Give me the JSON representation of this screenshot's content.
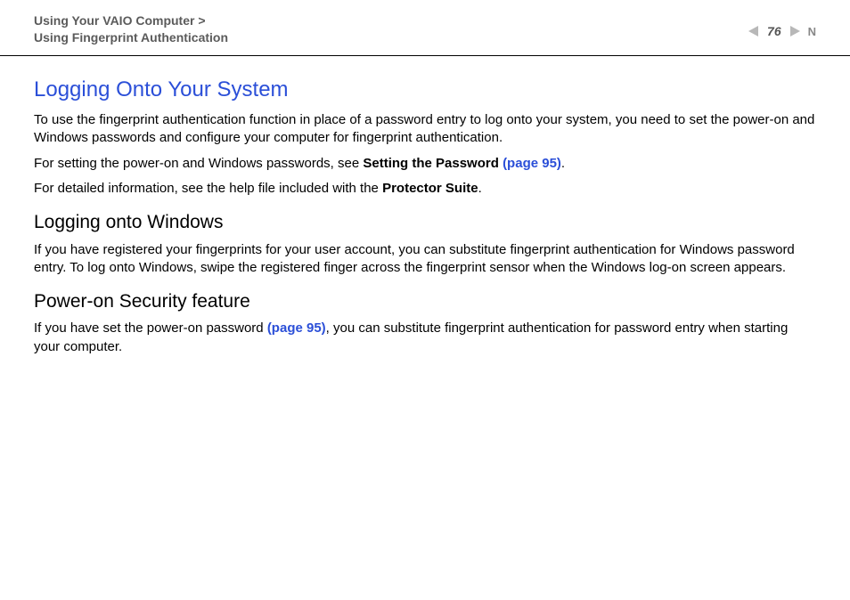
{
  "header": {
    "breadcrumb_line1": "Using Your VAIO Computer >",
    "breadcrumb_line2": "Using Fingerprint Authentication",
    "page_number": "76",
    "n_mark": "N"
  },
  "main": {
    "title": "Logging Onto Your System",
    "p1": "To use the fingerprint authentication function in place of a password entry to log onto your system, you need to set the power-on and Windows passwords and configure your computer for fingerprint authentication.",
    "p2_prefix": "For setting the power-on and Windows passwords, see ",
    "p2_bold": "Setting the Password ",
    "p2_link": "(page 95)",
    "p2_suffix": ".",
    "p3_prefix": "For detailed information, see the help file included with the ",
    "p3_bold": "Protector Suite",
    "p3_suffix": ".",
    "sub1": {
      "heading": "Logging onto Windows",
      "body": "If you have registered your fingerprints for your user account, you can substitute fingerprint authentication for Windows password entry. To log onto Windows, swipe the registered finger across the fingerprint sensor when the Windows log-on screen appears."
    },
    "sub2": {
      "heading": "Power-on Security feature",
      "body_prefix": "If you have set the power-on password ",
      "body_link": "(page 95)",
      "body_suffix": ", you can substitute fingerprint authentication for password entry when starting your computer."
    }
  }
}
